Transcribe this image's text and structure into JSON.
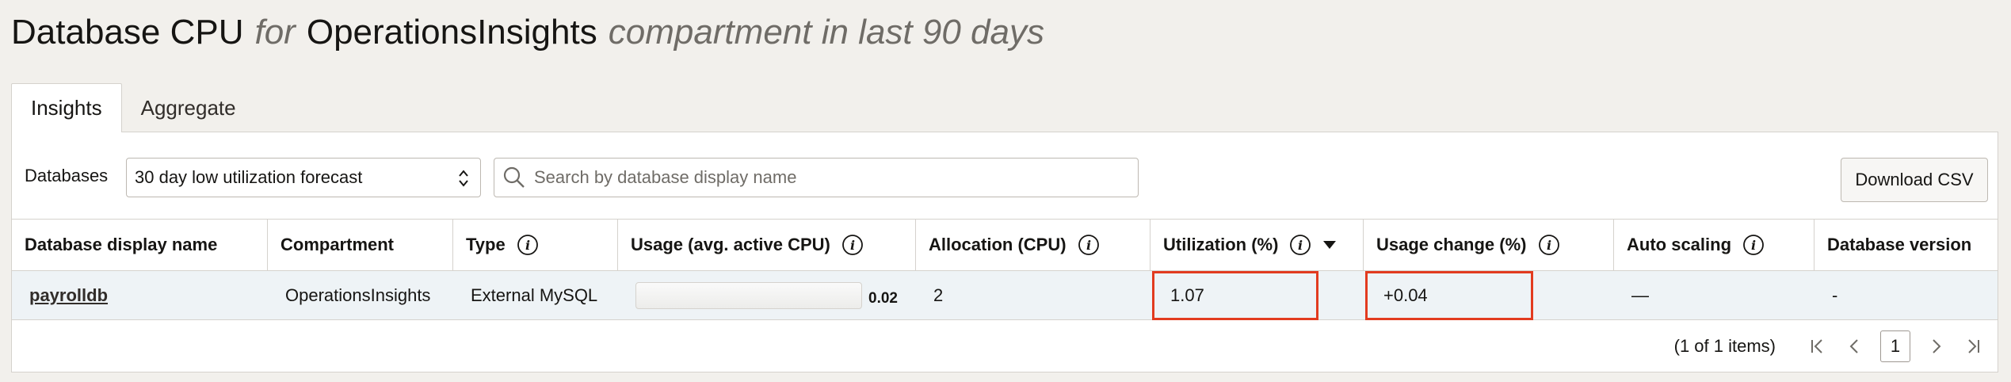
{
  "header": {
    "title": "Database CPU",
    "for_word": "for",
    "compartment": "OperationsInsights",
    "suffix": "compartment in last 90 days"
  },
  "tabs": [
    {
      "label": "Insights",
      "active": true
    },
    {
      "label": "Aggregate",
      "active": false
    }
  ],
  "toolbar": {
    "databases_label": "Databases",
    "filter_value": "30 day low utilization forecast",
    "search_placeholder": "Search by database display name",
    "download_label": "Download CSV"
  },
  "table": {
    "columns": [
      {
        "label": "Database display name",
        "info": false
      },
      {
        "label": "Compartment",
        "info": false
      },
      {
        "label": "Type",
        "info": true
      },
      {
        "label": "Usage (avg. active CPU)",
        "info": true
      },
      {
        "label": "Allocation (CPU)",
        "info": true
      },
      {
        "label": "Utilization (%)",
        "info": true,
        "sorted": "desc"
      },
      {
        "label": "Usage change (%)",
        "info": true
      },
      {
        "label": "Auto scaling",
        "info": true
      },
      {
        "label": "Database version",
        "info": false
      }
    ],
    "rows": [
      {
        "name": "payrolldb",
        "compartment": "OperationsInsights",
        "type": "External MySQL",
        "usage": "0.02",
        "usage_fraction": 0.0,
        "allocation": "2",
        "utilization": "1.07",
        "usage_change": "+0.04",
        "auto_scaling": "—",
        "version": "-"
      }
    ]
  },
  "pagination": {
    "summary": "(1 of 1 items)",
    "current_page": "1"
  },
  "colors": {
    "highlight": "#e23b1f",
    "row_selected": "#eef3f6",
    "background": "#f2f0ec"
  }
}
